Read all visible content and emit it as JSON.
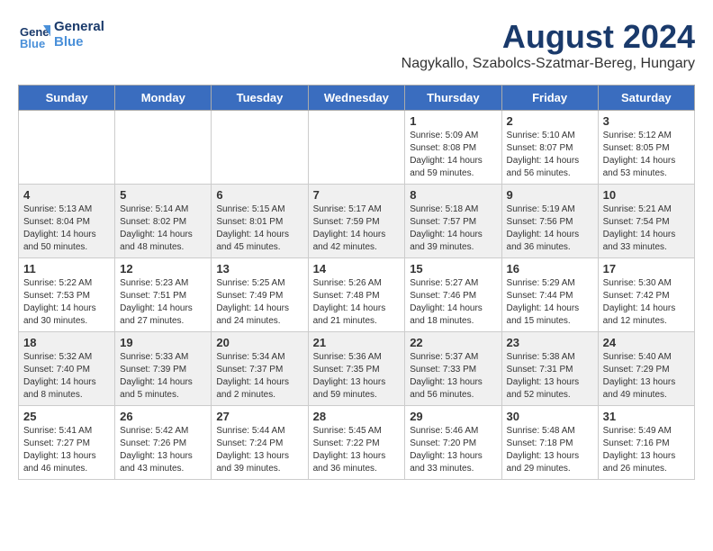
{
  "logo": {
    "line1": "General",
    "line2": "Blue"
  },
  "header": {
    "title": "August 2024",
    "subtitle": "Nagykallo, Szabolcs-Szatmar-Bereg, Hungary"
  },
  "weekdays": [
    "Sunday",
    "Monday",
    "Tuesday",
    "Wednesday",
    "Thursday",
    "Friday",
    "Saturday"
  ],
  "weeks": [
    [
      {
        "day": "",
        "info": ""
      },
      {
        "day": "",
        "info": ""
      },
      {
        "day": "",
        "info": ""
      },
      {
        "day": "",
        "info": ""
      },
      {
        "day": "1",
        "info": "Sunrise: 5:09 AM\nSunset: 8:08 PM\nDaylight: 14 hours\nand 59 minutes."
      },
      {
        "day": "2",
        "info": "Sunrise: 5:10 AM\nSunset: 8:07 PM\nDaylight: 14 hours\nand 56 minutes."
      },
      {
        "day": "3",
        "info": "Sunrise: 5:12 AM\nSunset: 8:05 PM\nDaylight: 14 hours\nand 53 minutes."
      }
    ],
    [
      {
        "day": "4",
        "info": "Sunrise: 5:13 AM\nSunset: 8:04 PM\nDaylight: 14 hours\nand 50 minutes."
      },
      {
        "day": "5",
        "info": "Sunrise: 5:14 AM\nSunset: 8:02 PM\nDaylight: 14 hours\nand 48 minutes."
      },
      {
        "day": "6",
        "info": "Sunrise: 5:15 AM\nSunset: 8:01 PM\nDaylight: 14 hours\nand 45 minutes."
      },
      {
        "day": "7",
        "info": "Sunrise: 5:17 AM\nSunset: 7:59 PM\nDaylight: 14 hours\nand 42 minutes."
      },
      {
        "day": "8",
        "info": "Sunrise: 5:18 AM\nSunset: 7:57 PM\nDaylight: 14 hours\nand 39 minutes."
      },
      {
        "day": "9",
        "info": "Sunrise: 5:19 AM\nSunset: 7:56 PM\nDaylight: 14 hours\nand 36 minutes."
      },
      {
        "day": "10",
        "info": "Sunrise: 5:21 AM\nSunset: 7:54 PM\nDaylight: 14 hours\nand 33 minutes."
      }
    ],
    [
      {
        "day": "11",
        "info": "Sunrise: 5:22 AM\nSunset: 7:53 PM\nDaylight: 14 hours\nand 30 minutes."
      },
      {
        "day": "12",
        "info": "Sunrise: 5:23 AM\nSunset: 7:51 PM\nDaylight: 14 hours\nand 27 minutes."
      },
      {
        "day": "13",
        "info": "Sunrise: 5:25 AM\nSunset: 7:49 PM\nDaylight: 14 hours\nand 24 minutes."
      },
      {
        "day": "14",
        "info": "Sunrise: 5:26 AM\nSunset: 7:48 PM\nDaylight: 14 hours\nand 21 minutes."
      },
      {
        "day": "15",
        "info": "Sunrise: 5:27 AM\nSunset: 7:46 PM\nDaylight: 14 hours\nand 18 minutes."
      },
      {
        "day": "16",
        "info": "Sunrise: 5:29 AM\nSunset: 7:44 PM\nDaylight: 14 hours\nand 15 minutes."
      },
      {
        "day": "17",
        "info": "Sunrise: 5:30 AM\nSunset: 7:42 PM\nDaylight: 14 hours\nand 12 minutes."
      }
    ],
    [
      {
        "day": "18",
        "info": "Sunrise: 5:32 AM\nSunset: 7:40 PM\nDaylight: 14 hours\nand 8 minutes."
      },
      {
        "day": "19",
        "info": "Sunrise: 5:33 AM\nSunset: 7:39 PM\nDaylight: 14 hours\nand 5 minutes."
      },
      {
        "day": "20",
        "info": "Sunrise: 5:34 AM\nSunset: 7:37 PM\nDaylight: 14 hours\nand 2 minutes."
      },
      {
        "day": "21",
        "info": "Sunrise: 5:36 AM\nSunset: 7:35 PM\nDaylight: 13 hours\nand 59 minutes."
      },
      {
        "day": "22",
        "info": "Sunrise: 5:37 AM\nSunset: 7:33 PM\nDaylight: 13 hours\nand 56 minutes."
      },
      {
        "day": "23",
        "info": "Sunrise: 5:38 AM\nSunset: 7:31 PM\nDaylight: 13 hours\nand 52 minutes."
      },
      {
        "day": "24",
        "info": "Sunrise: 5:40 AM\nSunset: 7:29 PM\nDaylight: 13 hours\nand 49 minutes."
      }
    ],
    [
      {
        "day": "25",
        "info": "Sunrise: 5:41 AM\nSunset: 7:27 PM\nDaylight: 13 hours\nand 46 minutes."
      },
      {
        "day": "26",
        "info": "Sunrise: 5:42 AM\nSunset: 7:26 PM\nDaylight: 13 hours\nand 43 minutes."
      },
      {
        "day": "27",
        "info": "Sunrise: 5:44 AM\nSunset: 7:24 PM\nDaylight: 13 hours\nand 39 minutes."
      },
      {
        "day": "28",
        "info": "Sunrise: 5:45 AM\nSunset: 7:22 PM\nDaylight: 13 hours\nand 36 minutes."
      },
      {
        "day": "29",
        "info": "Sunrise: 5:46 AM\nSunset: 7:20 PM\nDaylight: 13 hours\nand 33 minutes."
      },
      {
        "day": "30",
        "info": "Sunrise: 5:48 AM\nSunset: 7:18 PM\nDaylight: 13 hours\nand 29 minutes."
      },
      {
        "day": "31",
        "info": "Sunrise: 5:49 AM\nSunset: 7:16 PM\nDaylight: 13 hours\nand 26 minutes."
      }
    ]
  ]
}
